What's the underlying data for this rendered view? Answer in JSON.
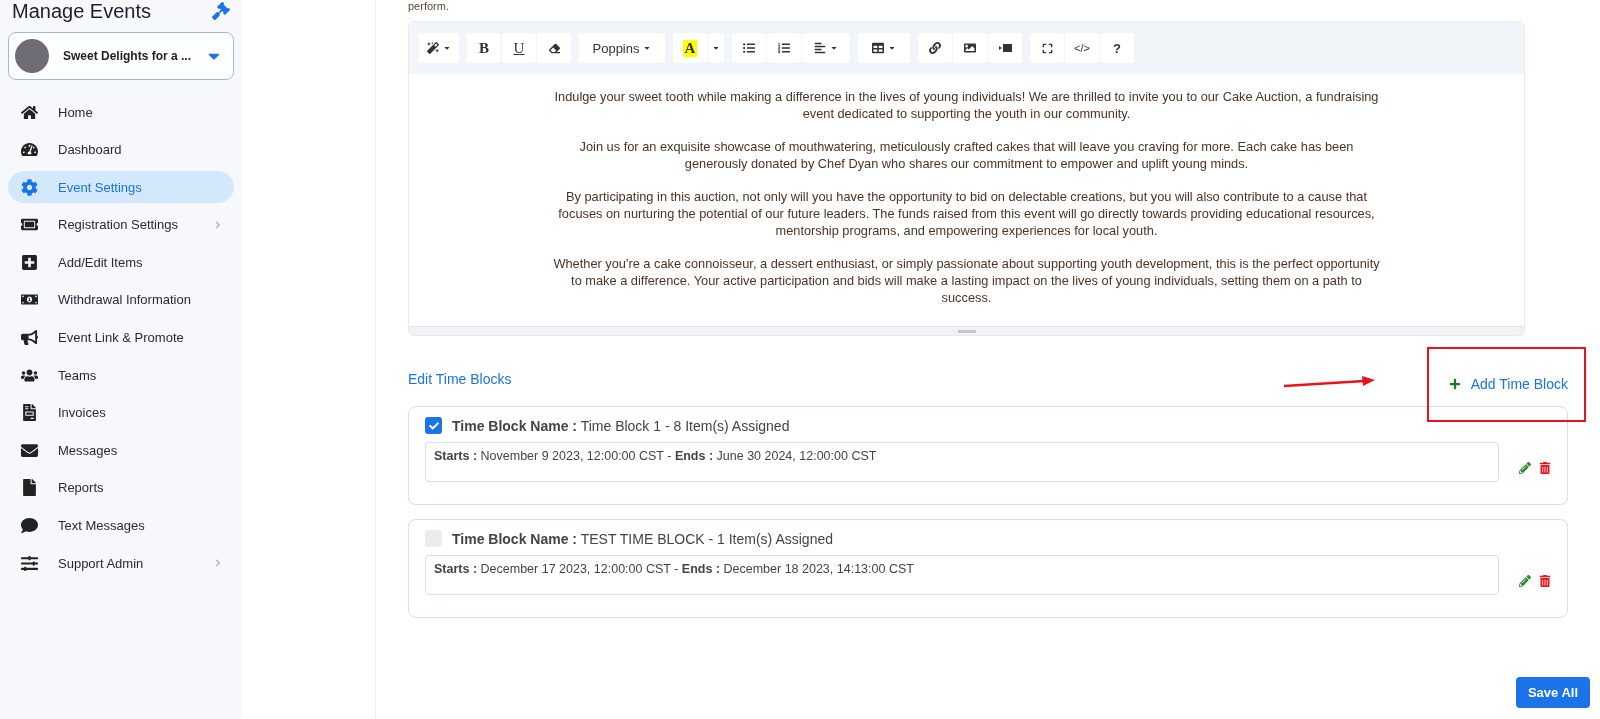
{
  "sidebar": {
    "title": "Manage Events",
    "event_selector": {
      "name": "Sweet Delights for a ..."
    },
    "items": [
      {
        "label": "Home",
        "selected": false,
        "submenu": false
      },
      {
        "label": "Dashboard",
        "selected": false,
        "submenu": false
      },
      {
        "label": "Event Settings",
        "selected": true,
        "submenu": false
      },
      {
        "label": "Registration Settings",
        "selected": false,
        "submenu": true
      },
      {
        "label": "Add/Edit Items",
        "selected": false,
        "submenu": false
      },
      {
        "label": "Withdrawal Information",
        "selected": false,
        "submenu": false
      },
      {
        "label": "Event Link & Promote",
        "selected": false,
        "submenu": false
      },
      {
        "label": "Teams",
        "selected": false,
        "submenu": false
      },
      {
        "label": "Invoices",
        "selected": false,
        "submenu": false
      },
      {
        "label": "Messages",
        "selected": false,
        "submenu": false
      },
      {
        "label": "Reports",
        "selected": false,
        "submenu": false
      },
      {
        "label": "Text Messages",
        "selected": false,
        "submenu": false
      },
      {
        "label": "Support Admin",
        "selected": false,
        "submenu": true
      }
    ]
  },
  "intro_text": "perform.",
  "editor": {
    "toolbar": {
      "bold": "B",
      "underline": "U",
      "font": "Poppins",
      "text_color_letter": "A",
      "code": "</>",
      "help": "?"
    },
    "paragraphs": [
      "Indulge your sweet tooth while making a difference in the lives of young individuals! We are thrilled to invite you to our Cake Auction, a fundraising event dedicated to supporting the youth in our community.",
      "Join us for an exquisite showcase of mouthwatering, meticulously crafted cakes that will leave you craving for more. Each cake has been generously donated by Chef Dyan who shares our commitment to empower and uplift young minds.",
      "By participating in this auction, not only will you have the opportunity to bid on delectable creations, but you will also contribute to a cause that focuses on nurturing the potential of our future leaders. The funds raised from this event will go directly towards providing educational resources, mentorship programs, and empowering experiences for local youth.",
      "Whether you're a cake connoisseur, a dessert enthusiast, or simply passionate about supporting youth development, this is the perfect opportunity to make a difference. Your active participation and bids will make a lasting impact on the lives of young individuals, setting them on a path to success."
    ]
  },
  "time_blocks": {
    "title": "Edit Time Blocks",
    "add_button": {
      "label": "Add Time Block",
      "highlighted": true
    },
    "items": [
      {
        "checked": true,
        "name": "**Time Block Name :** Time Block 1 - 8 Item(s) Assigned",
        "dates": "**Starts :** November 9 2023, 12:00:00 CST - **Ends :** June 30 2024, 12:00:00 CST"
      },
      {
        "checked": false,
        "name": "**Time Block Name :** TEST TIME BLOCK - 1 Item(s) Assigned",
        "dates": "**Starts :** December 17 2023, 12:00:00 CST - **Ends :** December 18 2023, 14:13:00 CST"
      }
    ]
  },
  "save_button": "Save All"
}
